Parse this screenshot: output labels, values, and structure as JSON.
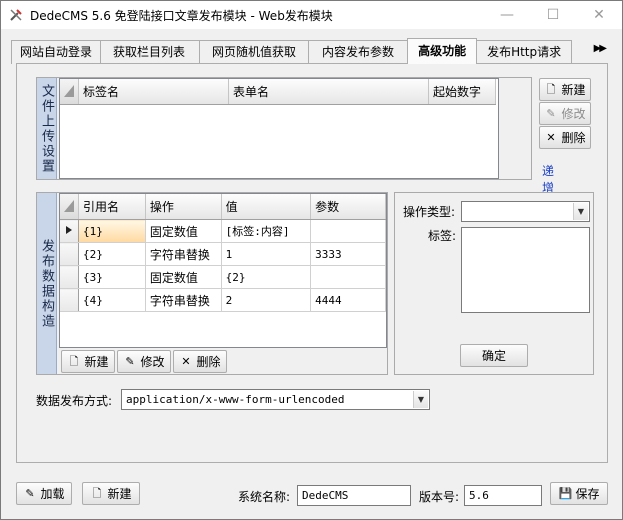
{
  "window": {
    "title": "DedeCMS 5.6 免登陆接口文章发布模块 - Web发布模块"
  },
  "tabs": [
    {
      "label": "网站自动登录"
    },
    {
      "label": "获取栏目列表"
    },
    {
      "label": "网页随机值获取"
    },
    {
      "label": "内容发布参数"
    },
    {
      "label": "高级功能"
    },
    {
      "label": "发布Http请求"
    }
  ],
  "upload_group": {
    "label": "文件上传设置",
    "columns": [
      "标签名",
      "表单名",
      "起始数字"
    ],
    "buttons": {
      "new": "新建",
      "edit": "修改",
      "delete": "删除"
    },
    "link": "递增数字"
  },
  "data_group": {
    "label": "发布数据构造",
    "columns": [
      "引用名",
      "操作",
      "值",
      "参数"
    ],
    "rows": [
      {
        "ref": "{1}",
        "op": "固定数值",
        "value": "[标签:内容]",
        "param": ""
      },
      {
        "ref": "{2}",
        "op": "字符串替换",
        "value": "1",
        "param": "3333"
      },
      {
        "ref": "{3}",
        "op": "固定数值",
        "value": "{2}",
        "param": ""
      },
      {
        "ref": "{4}",
        "op": "字符串替换",
        "value": "2",
        "param": "4444"
      }
    ],
    "buttons": {
      "new": "新建",
      "edit": "修改",
      "delete": "删除"
    }
  },
  "op_panel": {
    "type_label": "操作类型:",
    "type_value": "",
    "tag_label": "标签:",
    "confirm": "确定"
  },
  "publish": {
    "label": "数据发布方式:",
    "value": "application/x-www-form-urlencoded"
  },
  "footer": {
    "load": "加载",
    "new": "新建",
    "system_label": "系统名称:",
    "system_value": "DedeCMS",
    "version_label": "版本号:",
    "version_value": "5.6",
    "save": "保存"
  }
}
